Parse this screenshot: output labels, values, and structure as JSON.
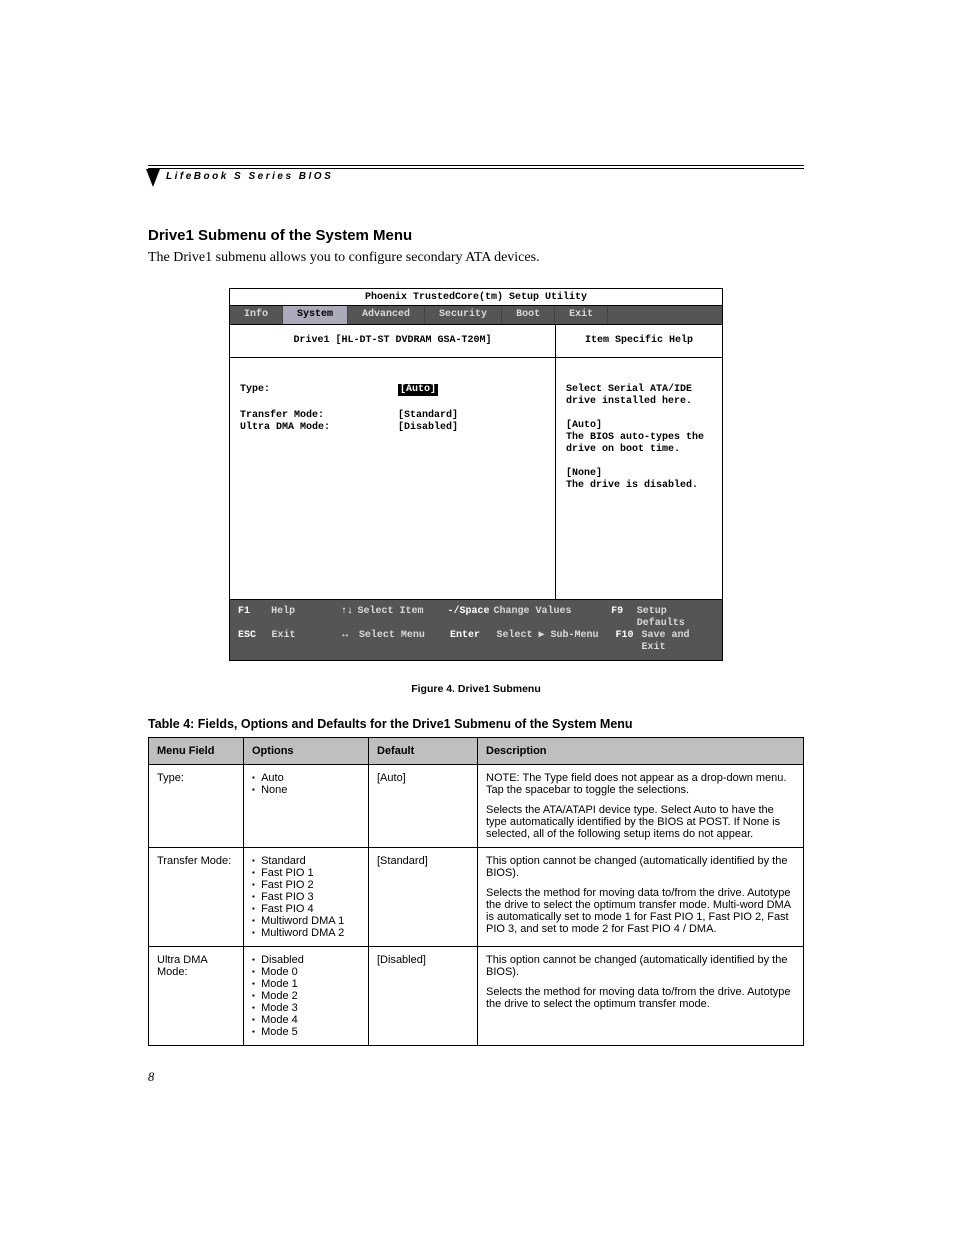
{
  "header": "LifeBook S Series BIOS",
  "section_title": "Drive1 Submenu of the System Menu",
  "intro": "The Drive1 submenu allows you to configure secondary ATA devices.",
  "bios": {
    "title": "Phoenix TrustedCore(tm) Setup Utility",
    "tabs": [
      "Info",
      "System",
      "Advanced",
      "Security",
      "Boot",
      "Exit"
    ],
    "active_tab": "System",
    "submenu_header": "Drive1 [HL-DT-ST DVDRAM GSA-T20M]",
    "fields": [
      {
        "label": "Type:",
        "value": "[Auto]",
        "selected": true
      },
      {
        "label": "Transfer Mode:",
        "value": "[Standard]",
        "selected": false
      },
      {
        "label": "Ultra DMA Mode:",
        "value": "[Disabled]",
        "selected": false
      }
    ],
    "help_title": "Item Specific Help",
    "help_lines": [
      "Select Serial ATA/IDE",
      "drive installed here.",
      "",
      "[Auto]",
      "The BIOS auto-types the",
      "drive on boot time.",
      "",
      "[None]",
      "The drive is disabled."
    ],
    "footer": {
      "row1": {
        "k1": "F1",
        "l1": "Help",
        "k2": "↑↓",
        "l2": "Select Item",
        "k3": "-/Space",
        "l3": "Change Values",
        "k4": "F9",
        "l4": "Setup Defaults"
      },
      "row2": {
        "k1": "ESC",
        "l1": "Exit",
        "k2": "↔",
        "l2": "Select Menu",
        "k3": "Enter",
        "l3": "Select ▶ Sub-Menu",
        "k4": "F10",
        "l4": "Save and Exit"
      }
    }
  },
  "figure_caption": "Figure 4.  Drive1 Submenu",
  "table_caption": "Table 4: Fields, Options and Defaults for the Drive1 Submenu of the System Menu",
  "table": {
    "headers": [
      "Menu Field",
      "Options",
      "Default",
      "Description"
    ],
    "rows": [
      {
        "field": "Type:",
        "options": [
          "Auto",
          "None"
        ],
        "default": "[Auto]",
        "description": [
          "NOTE: The Type field does not appear as a drop-down menu. Tap the spacebar to toggle the selections.",
          "Selects the ATA/ATAPI device type. Select Auto to have the type automatically identified by the BIOS at POST. If None is selected, all of the following setup items do not appear."
        ]
      },
      {
        "field": "Transfer Mode:",
        "options": [
          "Standard",
          "Fast PIO 1",
          "Fast PIO 2",
          "Fast PIO 3",
          "Fast PIO 4",
          "Multiword DMA 1",
          "Multiword DMA 2"
        ],
        "default": "[Standard]",
        "description": [
          "This option cannot be changed (automatically identified by the BIOS).",
          "Selects the method for moving data to/from the drive. Autotype the drive to select the optimum transfer mode.  Multi-word DMA is automatically set to mode 1 for Fast PIO 1, Fast PIO 2, Fast PIO 3, and set to mode 2 for Fast PIO 4 / DMA."
        ]
      },
      {
        "field": "Ultra DMA Mode:",
        "options": [
          "Disabled",
          "Mode 0",
          "Mode 1",
          "Mode 2",
          "Mode 3",
          "Mode 4",
          "Mode 5"
        ],
        "default": "[Disabled]",
        "description": [
          "This option cannot be changed (automatically identified by the BIOS).",
          "Selects the method for moving data to/from the drive. Autotype the drive to select the optimum transfer mode."
        ]
      }
    ]
  },
  "page_number": "8"
}
